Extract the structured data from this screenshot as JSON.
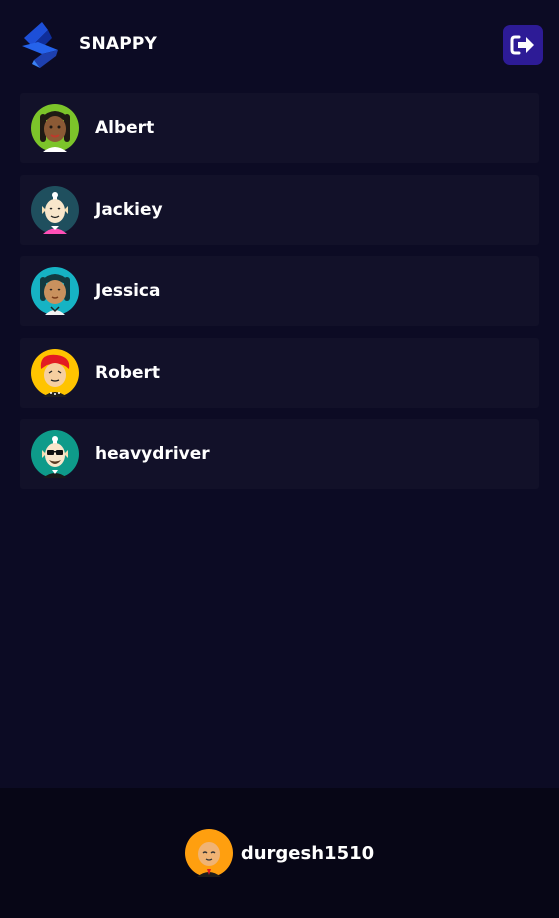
{
  "app": {
    "brand_name": "SNAPPY",
    "logo_icon": "snappy-logo-icon",
    "logout_icon": "logout-icon"
  },
  "colors": {
    "background": "#0c0b24",
    "contact_card": "#121129",
    "footer": "#070616",
    "accent": "#2d1b96"
  },
  "contacts": [
    {
      "name": "Albert",
      "avatar": "avatar-green-dreadlocks-icon"
    },
    {
      "name": "Jackiey",
      "avatar": "avatar-teal-bald-icon"
    },
    {
      "name": "Jessica",
      "avatar": "avatar-cyan-dreadlocks-icon"
    },
    {
      "name": "Robert",
      "avatar": "avatar-red-hair-icon"
    },
    {
      "name": "heavydriver",
      "avatar": "avatar-sunglasses-icon"
    }
  ],
  "current_user": {
    "username": "durgesh1510",
    "avatar": "avatar-orange-icon"
  }
}
